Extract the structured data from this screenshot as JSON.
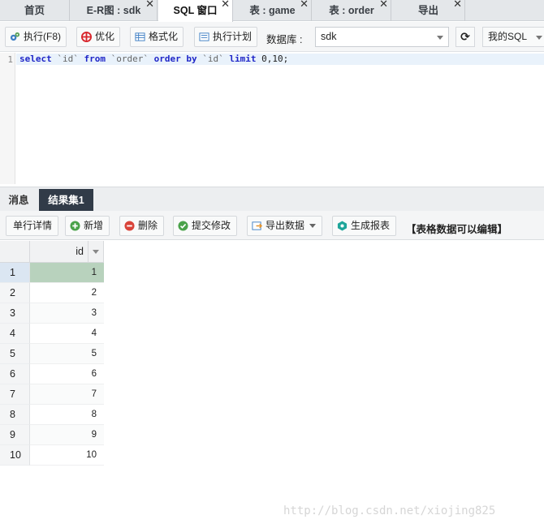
{
  "tabs": [
    {
      "label": "首页",
      "closable": false,
      "active": false
    },
    {
      "label": "E-R图 : sdk",
      "closable": true,
      "active": false
    },
    {
      "label": "SQL 窗口",
      "closable": true,
      "active": true
    },
    {
      "label": "表 : game",
      "closable": true,
      "active": false
    },
    {
      "label": "表 : order",
      "closable": true,
      "active": false
    },
    {
      "label": "导出",
      "closable": true,
      "active": false
    }
  ],
  "toolbar": {
    "run": "执行(F8)",
    "optimize": "优化",
    "format": "格式化",
    "explain": "执行计划",
    "database_label": "数据库 :",
    "database_value": "sdk",
    "my_sql": "我的SQL"
  },
  "editor": {
    "line_number": "1",
    "sql": {
      "kw_select": "select",
      "col1": "`id`",
      "kw_from": "from",
      "table": "`order`",
      "kw_order_by": "order by",
      "col2": "`id`",
      "kw_limit": "limit",
      "limit_args": "0,10;"
    }
  },
  "result_tabs": {
    "messages": "消息",
    "resultset": "结果集1"
  },
  "result_toolbar": {
    "row_detail": "单行详情",
    "add": "新增",
    "delete": "删除",
    "commit": "提交修改",
    "export": "导出数据",
    "report": "生成报表",
    "editable_note": "【表格数据可以编辑】"
  },
  "grid": {
    "column": "id",
    "rows": [
      {
        "rownum": "1",
        "id": "1"
      },
      {
        "rownum": "2",
        "id": "2"
      },
      {
        "rownum": "3",
        "id": "3"
      },
      {
        "rownum": "4",
        "id": "4"
      },
      {
        "rownum": "5",
        "id": "5"
      },
      {
        "rownum": "6",
        "id": "6"
      },
      {
        "rownum": "7",
        "id": "7"
      },
      {
        "rownum": "8",
        "id": "8"
      },
      {
        "rownum": "9",
        "id": "9"
      },
      {
        "rownum": "10",
        "id": "10"
      }
    ]
  },
  "watermark": "http://blog.csdn.net/xiojing825",
  "colors": {
    "active_result_tab": "#313b48",
    "sql_keyword": "#1f26c8",
    "selected_cell": "#b8d2bd",
    "selected_rownum": "#dbe6f2"
  }
}
